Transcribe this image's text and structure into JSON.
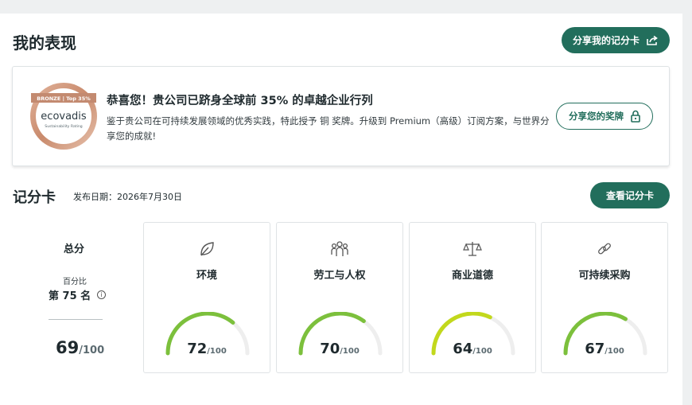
{
  "header": {
    "title": "我的表现",
    "share_scorecard_label": "分享我的记分卡"
  },
  "award": {
    "medal": {
      "level": "BRONZE",
      "top": "Top 35%",
      "brand": "ecovadis",
      "subtitle": "Sustainability Rating"
    },
    "heading": "恭喜您！贵公司已跻身全球前 35% 的卓越企业行列",
    "text": "鉴于贵公司在可持续发展领域的优秀实践，特此授予 铜 奖牌。升级到 Premium（高级）订阅方案，与世界分享您的成就!",
    "share_badge_label": "分享您的奖牌"
  },
  "scorecard": {
    "title": "记分卡",
    "publish_date": "发布日期：2026年7月30日",
    "view_label": "查看记分卡",
    "overall": {
      "label": "总分",
      "percentile_label": "百分比",
      "rank": "第 75 名",
      "info_icon": "i",
      "score": "69",
      "denominator": "/100"
    },
    "themes": [
      {
        "name": "环境",
        "icon": "leaf-icon",
        "score": "72",
        "denominator": "/100",
        "value": 72,
        "color": "#7cc03c"
      },
      {
        "name": "劳工与人权",
        "icon": "people-icon",
        "score": "70",
        "denominator": "/100",
        "value": 70,
        "color": "#7cc03c"
      },
      {
        "name": "商业道德",
        "icon": "scales-icon",
        "score": "64",
        "denominator": "/100",
        "value": 64,
        "color": "#c2d81c"
      },
      {
        "name": "可持续采购",
        "icon": "link-icon",
        "score": "67",
        "denominator": "/100",
        "value": 67,
        "color": "#7cc03c"
      }
    ]
  },
  "colors": {
    "brand": "#226e5c",
    "gauge_track": "#eeeeee"
  }
}
